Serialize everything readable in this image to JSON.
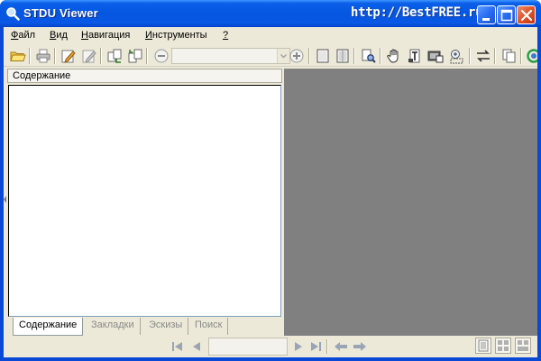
{
  "window": {
    "title": "STDU Viewer",
    "watermark": "http://BestFREE.ru",
    "controls": [
      "minimize",
      "maximize",
      "close"
    ]
  },
  "menu": {
    "items": [
      {
        "label": "Файл",
        "underline": "Ф"
      },
      {
        "label": "Вид",
        "underline": "В"
      },
      {
        "label": "Навигация",
        "underline": "Н"
      },
      {
        "label": "Инструменты",
        "underline": "И"
      },
      {
        "label": "?",
        "underline": "?"
      }
    ]
  },
  "toolbar": {
    "buttons": [
      "open-folder-icon",
      "print-icon",
      "edit-icon",
      "edit-disabled-icon",
      "copy-page-icon",
      "paste-page-icon",
      "zoom-out-icon",
      "zoom-in-icon",
      "single-page-icon",
      "facing-pages-icon",
      "find-icon",
      "hand-tool-icon",
      "text-select-icon",
      "snapshot-icon",
      "zoom-area-icon",
      "rotate-icon",
      "copy-icon",
      "refresh-icon"
    ],
    "zoom_value": ""
  },
  "panel": {
    "header": "Содержание",
    "tabs": [
      {
        "label": "Содержание",
        "active": true
      },
      {
        "label": "Закладки",
        "active": false
      },
      {
        "label": "Эскизы",
        "active": false
      },
      {
        "label": "Поиск",
        "active": false
      }
    ]
  },
  "statusbar": {
    "page_value": "",
    "nav_buttons": [
      "first-page-icon",
      "prev-page-icon",
      "next-page-icon",
      "last-page-icon",
      "back-icon",
      "forward-icon"
    ],
    "view_buttons": [
      "single-view-icon",
      "grid-view-icon",
      "tile-view-icon"
    ]
  },
  "colors": {
    "titlebar": "#0556e0",
    "chrome": "#ece9d8",
    "document_background": "#808080"
  }
}
